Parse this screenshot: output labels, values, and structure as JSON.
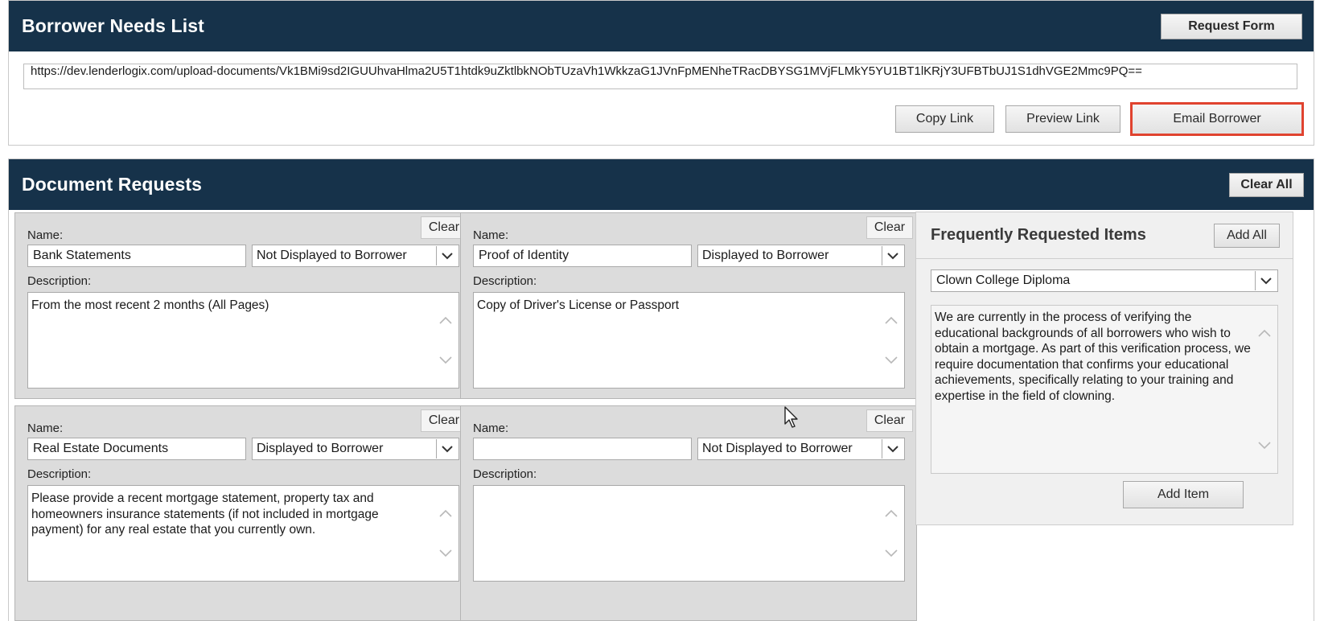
{
  "borrower_needs": {
    "title": "Borrower Needs List",
    "request_form_label": "Request Form",
    "upload_url": "https://dev.lenderlogix.com/upload-documents/Vk1BMi9sd2IGUUhvaHlma2U5T1htdk9uZktlbkNObTUzaVh1WkkzaG1JVnFpMENheTRacDBYSG1MVjFLMkY5YU1BT1lKRjY3UFBTbUJ1S1dhVGE2Mmc9PQ==",
    "copy_link_label": "Copy Link",
    "preview_link_label": "Preview Link",
    "email_borrower_label": "Email Borrower",
    "highlight_color": "#e0432f"
  },
  "document_requests": {
    "title": "Document Requests",
    "clear_all_label": "Clear All",
    "name_label": "Name:",
    "description_label": "Description:",
    "clear_label": "Clear",
    "cards": [
      {
        "name": "Bank Statements",
        "visibility": "Not Displayed to Borrower",
        "description": "From the most recent 2 months (All Pages)"
      },
      {
        "name": "Proof of Identity",
        "visibility": "Displayed to Borrower",
        "description": "Copy of Driver's License or Passport"
      },
      {
        "name": "Real Estate Documents",
        "visibility": "Displayed to Borrower",
        "description": "Please provide a recent mortgage statement, property tax and homeowners insurance statements (if not included in mortgage payment) for any real estate that you currently own."
      },
      {
        "name": "",
        "visibility": "Not Displayed to Borrower",
        "description": ""
      }
    ]
  },
  "frequently_requested": {
    "title": "Frequently Requested Items",
    "add_all_label": "Add All",
    "selected_item": "Clown College Diploma",
    "description": "We are currently in the process of verifying the educational backgrounds of all borrowers who wish to obtain a mortgage. As part of this verification process, we require documentation that confirms your educational achievements, specifically relating to your training and expertise in the field of clowning.",
    "add_item_label": "Add Item"
  },
  "colors": {
    "header_bg": "#16324a",
    "card_bg": "#dcdcdc"
  }
}
